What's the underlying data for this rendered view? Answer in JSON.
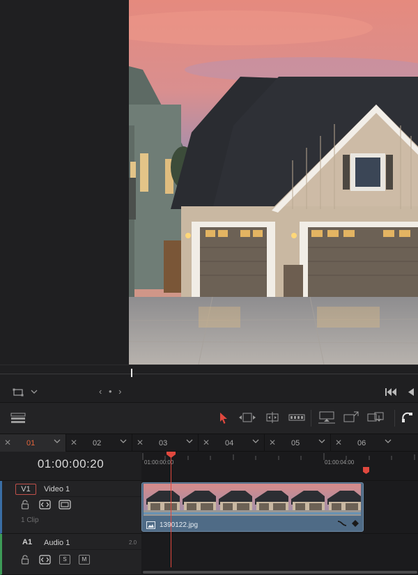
{
  "viewer": {
    "image_alt": "two-story house with attached double garage at sunset"
  },
  "transport": {
    "nav_dots": "‹ • ›"
  },
  "timeline_tabs": [
    {
      "label": "01",
      "active": true
    },
    {
      "label": "02",
      "active": false
    },
    {
      "label": "03",
      "active": false
    },
    {
      "label": "04",
      "active": false
    },
    {
      "label": "05",
      "active": false
    },
    {
      "label": "06",
      "active": false
    }
  ],
  "timecode": "01:00:00:20",
  "ruler": {
    "start": "01:00:00:00",
    "mark": "01:00:04:00"
  },
  "tracks": {
    "video": {
      "id": "V1",
      "name": "Video 1",
      "clip_count": "1 Clip"
    },
    "audio": {
      "id": "A1",
      "name": "Audio 1",
      "level": "2.0",
      "solo": "S",
      "mute": "M"
    }
  },
  "clip": {
    "name": "1390122.jpg"
  },
  "colors": {
    "accent": "#e2643b",
    "playhead": "#e0483e",
    "video_track": "#3a6ea5",
    "audio_track": "#3d9b57",
    "clip": "#4f6b86"
  }
}
